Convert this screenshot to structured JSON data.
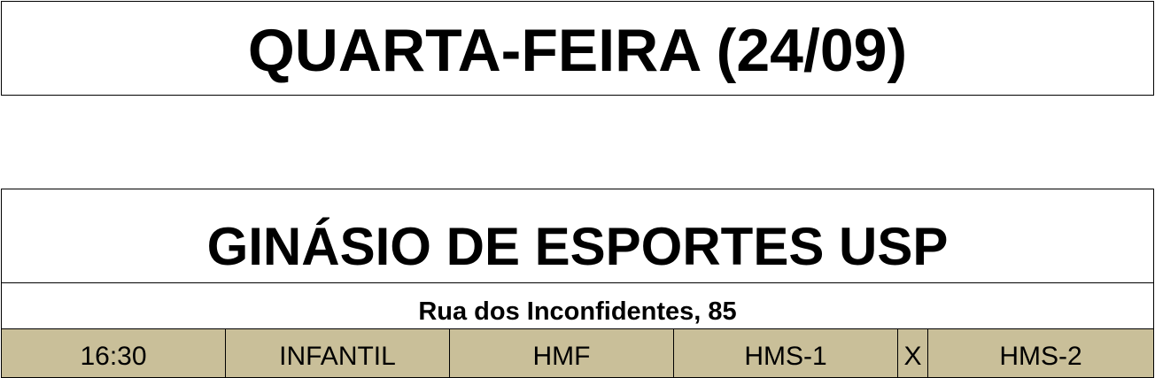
{
  "day": {
    "title": "QUARTA-FEIRA (24/09)"
  },
  "venue": {
    "name": "GINÁSIO DE ESPORTES USP",
    "address": "Rua dos Inconfidentes, 85"
  },
  "matches": [
    {
      "time": "16:30",
      "category": "INFANTIL",
      "modality": "HMF",
      "team1": "HMS-1",
      "vs": "X",
      "team2": "HMS-2"
    }
  ],
  "colors": {
    "match_row_background": "#c9bf99",
    "border": "#000000"
  }
}
